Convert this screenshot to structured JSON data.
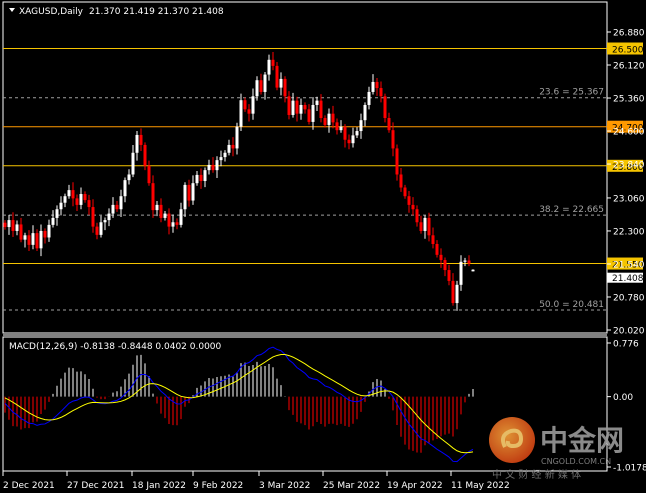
{
  "header": {
    "symbol_label": "XAGUSD,Daily",
    "ohlc_text": "21.370 21.419 21.370 21.408"
  },
  "colors": {
    "background": "#000000",
    "bull_candle": "#ffffff",
    "bear_candle": "#ff0000",
    "level_line": "#f5c400",
    "level_line_alt": "#ff9900",
    "fib_line": "#a0a0a0",
    "macd_line": "#0000ff",
    "signal_line": "#ffff00",
    "hist_positive": "#ffffff",
    "hist_negative": "#ff0000"
  },
  "chart_data": [
    {
      "type": "candlestick",
      "title": "XAGUSD,Daily",
      "last_bar": {
        "open": 21.37,
        "high": 21.419,
        "low": 21.37,
        "close": 21.408
      },
      "ylim": [
        20.02,
        26.88
      ],
      "y_ticks": [
        "26.880",
        "26.120",
        "25.360",
        "24.600",
        "23.840",
        "23.060",
        "22.300",
        "21.540",
        "20.780",
        "20.020"
      ],
      "x_tick_labels": [
        "2 Dec 2021",
        "27 Dec 2021",
        "18 Jan 2022",
        "9 Feb 2022",
        "3 Mar 2022",
        "25 Mar 2022",
        "19 Apr 2022",
        "11 May 2022"
      ],
      "close": [
        22.39,
        22.55,
        22.3,
        22.45,
        22.1,
        22.2,
        21.98,
        22.25,
        21.9,
        22.3,
        22.15,
        22.44,
        22.6,
        22.8,
        22.95,
        23.1,
        23.24,
        23.05,
        22.9,
        23.15,
        23.01,
        22.85,
        22.4,
        22.21,
        22.5,
        22.55,
        22.7,
        22.9,
        22.8,
        23.1,
        23.47,
        23.6,
        24.1,
        24.51,
        24.28,
        23.8,
        23.4,
        22.78,
        22.9,
        22.6,
        22.7,
        22.4,
        22.5,
        22.44,
        22.8,
        23.36,
        23.0,
        23.4,
        23.59,
        23.45,
        23.7,
        23.82,
        23.7,
        23.93,
        24.0,
        24.1,
        24.28,
        24.2,
        24.7,
        25.31,
        25.1,
        25.0,
        25.4,
        25.77,
        25.5,
        25.9,
        26.24,
        26.1,
        25.6,
        25.8,
        25.4,
        24.97,
        25.3,
        25.0,
        25.2,
        25.1,
        24.81,
        25.2,
        25.3,
        24.9,
        24.74,
        25.0,
        24.8,
        24.62,
        24.7,
        24.4,
        24.32,
        24.5,
        24.6,
        24.85,
        25.2,
        25.5,
        25.73,
        25.59,
        25.4,
        24.9,
        24.62,
        24.2,
        23.6,
        23.3,
        23.1,
        22.9,
        22.8,
        22.5,
        22.3,
        22.6,
        22.2,
        22.0,
        21.75,
        21.63,
        21.4,
        21.15,
        20.64,
        21.06,
        21.59,
        21.62,
        21.55,
        21.408
      ],
      "levels": [
        {
          "price": 26.5,
          "label": "26.500",
          "style": "gold"
        },
        {
          "price": 24.7,
          "label": "24.700",
          "style": "orange"
        },
        {
          "price": 23.8,
          "label": "23.800",
          "style": "gold"
        },
        {
          "price": 21.55,
          "label": "21.550",
          "style": "gold"
        }
      ],
      "fibonacci": [
        {
          "price": 25.367,
          "label": "23.6 = 25.367"
        },
        {
          "price": 22.665,
          "label": "38.2 = 22.665"
        },
        {
          "price": 20.481,
          "label": "50.0 = 20.481"
        }
      ],
      "current_price_label": "21.408"
    },
    {
      "type": "line",
      "title": "MACD(12,26,9) -0.8138 -0.8448 0.0402 0.0000",
      "ylim": [
        -1.0178,
        0.776
      ],
      "y_ticks": [
        "0.776",
        "0.00",
        "-1.0178"
      ],
      "series": [
        {
          "name": "MACD",
          "role": "macd"
        },
        {
          "name": "Signal",
          "role": "signal"
        },
        {
          "name": "Histogram",
          "role": "histogram"
        }
      ]
    }
  ],
  "watermark": {
    "brand": "中金网",
    "domain": "CNGOLD.COM.CN",
    "tagline": "中 文 财 经 新 媒 体"
  }
}
